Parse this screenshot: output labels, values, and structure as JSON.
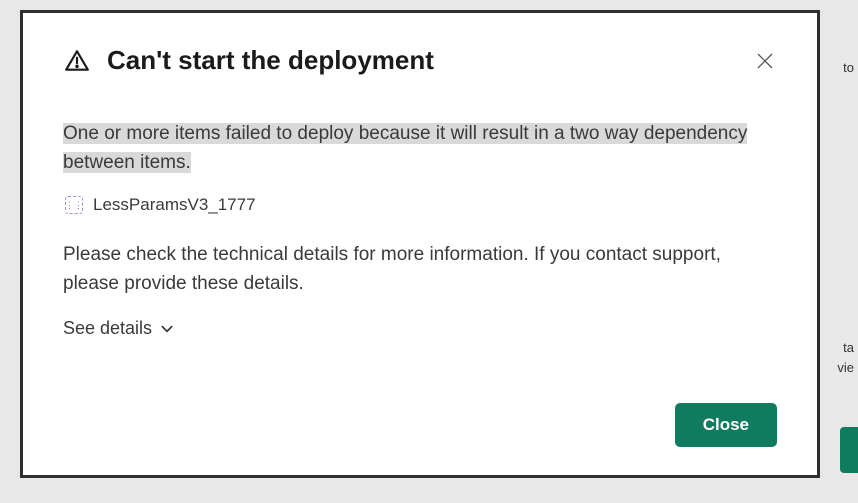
{
  "dialog": {
    "title": "Can't start the deployment",
    "errorMessage": "One or more items failed to deploy because it will result in a two way dependency between items.",
    "item": {
      "name": "LessParamsV3_1777"
    },
    "subMessage": "Please check the technical details for more information. If you contact support, please provide these details.",
    "seeDetailsLabel": "See details",
    "closeButtonLabel": "Close"
  },
  "bg": {
    "frag1": "to",
    "frag2": "ta",
    "frag3": "vie"
  }
}
